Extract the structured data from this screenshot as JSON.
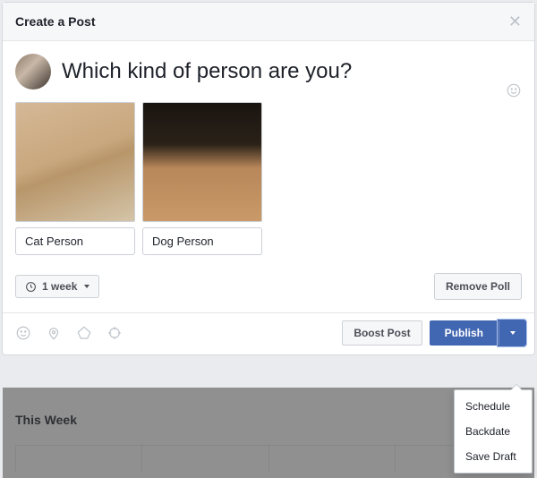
{
  "header": {
    "title": "Create a Post"
  },
  "compose": {
    "text": "Which kind of person are you?"
  },
  "poll": {
    "options": [
      {
        "label": "Cat Person"
      },
      {
        "label": "Dog Person"
      }
    ],
    "duration": "1 week",
    "remove_label": "Remove Poll"
  },
  "footer": {
    "boost_label": "Boost Post",
    "publish_label": "Publish"
  },
  "dropdown": {
    "items": [
      "Schedule",
      "Backdate",
      "Save Draft"
    ]
  },
  "background": {
    "section_title": "This Week"
  }
}
